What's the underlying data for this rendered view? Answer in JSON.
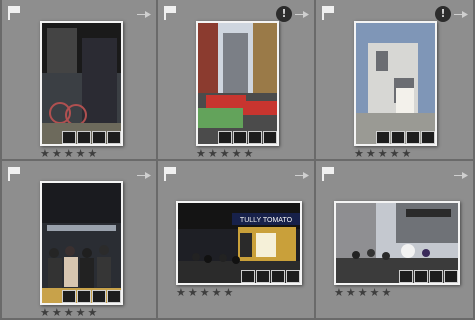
{
  "grid": {
    "cells": [
      {
        "id": "c1",
        "badge": false,
        "rating_stars": [
          "★",
          "★",
          "★",
          "★",
          "★"
        ],
        "photo": "bicycle-station"
      },
      {
        "id": "c2",
        "badge": true,
        "badge_text": "!",
        "rating_stars": [
          "★",
          "★",
          "★",
          "★",
          "★"
        ],
        "photo": "taxis-street"
      },
      {
        "id": "c3",
        "badge": true,
        "badge_text": "!",
        "rating_stars": [
          "★",
          "★",
          "★",
          "★",
          "★"
        ],
        "photo": "building-vending"
      },
      {
        "id": "c4",
        "badge": false,
        "rating_stars": [
          "★",
          "★",
          "★",
          "★",
          "★"
        ],
        "photo": "crowd-platform"
      },
      {
        "id": "c5",
        "badge": false,
        "rating_stars": [
          "★",
          "★",
          "★",
          "★",
          "★"
        ],
        "photo": "storefront-night",
        "sign_text": "TULLY TOMATO"
      },
      {
        "id": "c6",
        "badge": false,
        "rating_stars": [
          "★",
          "★",
          "★",
          "★",
          "★"
        ],
        "photo": "plaza-crowd"
      }
    ]
  },
  "icons": {
    "flag": "flag-icon",
    "rotate": "rotate-arrow-icon",
    "badge": "alert-badge-icon",
    "overlay": [
      "crop-icon",
      "metadata-icon",
      "keyword-icon",
      "adjust-icon"
    ]
  }
}
